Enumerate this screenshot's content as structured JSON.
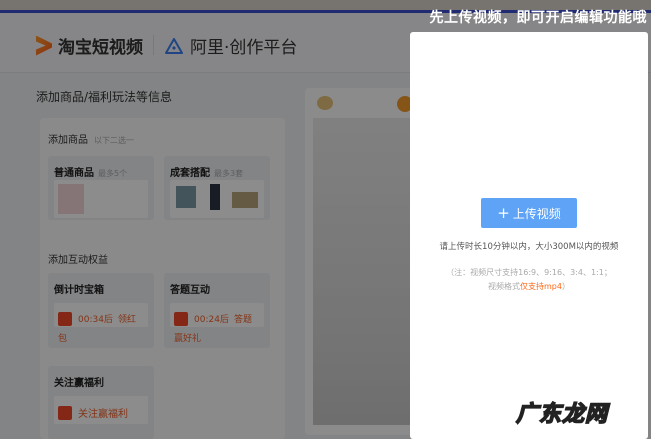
{
  "header": {
    "brand": "淘宝短视频",
    "platform": "阿里·创作平台"
  },
  "main": {
    "title": "添加商品/福利玩法等信息",
    "products": {
      "label": "添加商品",
      "hint": "以下二选一",
      "normal": {
        "title": "普通商品",
        "hint": "最多5个"
      },
      "outfit": {
        "title": "成套搭配",
        "hint": "最多3套"
      }
    },
    "interactive": {
      "label": "添加互动权益",
      "countdown": {
        "title": "倒计时宝箱",
        "time": "00:34后",
        "action": "领红包"
      },
      "quiz": {
        "title": "答题互动",
        "time": "00:24后",
        "action": "答题赢好礼"
      },
      "follow": {
        "title": "关注赢福利",
        "action": "关注赢福利"
      }
    }
  },
  "modal": {
    "banner": "先上传视频，即可开启编辑功能哦",
    "upload_label": "上传视频",
    "hint": "请上传时长10分钟以内，大小300M以内的视频",
    "note_line1": "（注：视频尺寸支持16:9、9:16、3:4、1:1；",
    "note_line2_prefix": "视频格式",
    "note_line2_highlight": "仅支持mp4",
    "note_line2_suffix": "）"
  },
  "watermark": "广东龙网",
  "colors": {
    "accent": "#5ea3f5",
    "orange": "#ff6a1a",
    "red": "#f2482a"
  }
}
